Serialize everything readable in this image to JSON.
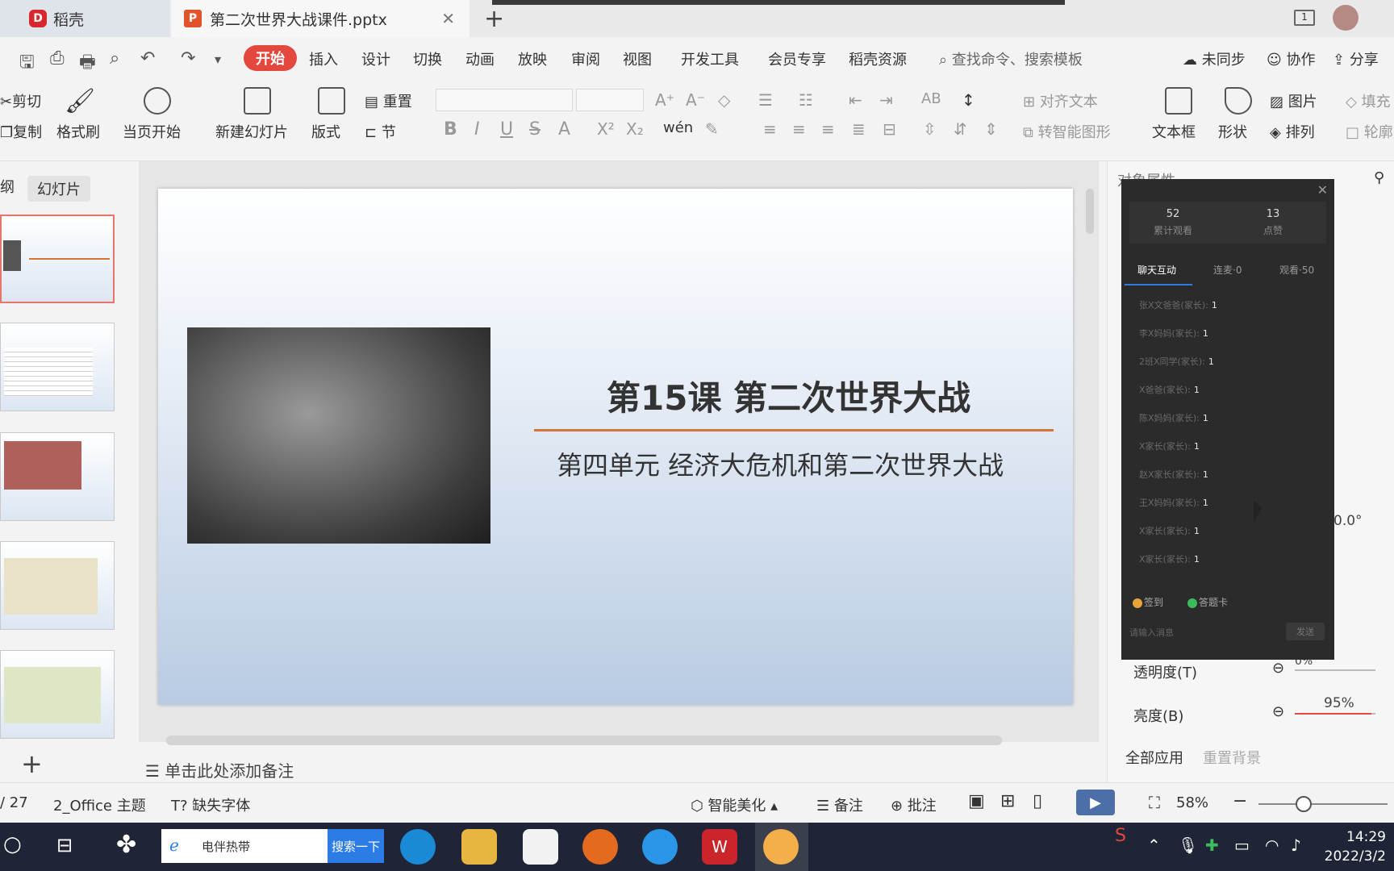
{
  "tabs": [
    {
      "label": "稻壳"
    },
    {
      "label": "第二次世界大战课件.pptx"
    }
  ],
  "menu": {
    "active": "开始",
    "items": [
      "插入",
      "设计",
      "切换",
      "动画",
      "放映",
      "审阅",
      "视图",
      "开发工具",
      "会员专享",
      "稻壳资源"
    ],
    "search_placeholder": "查找命令、搜索模板",
    "right": [
      "未同步",
      "协作",
      "分享"
    ]
  },
  "ribbon": {
    "cut": "剪切",
    "copy": "复制",
    "format_painter": "格式刷",
    "play_from_current": "当页开始",
    "new_slide": "新建幻灯片",
    "layout": "版式",
    "reset": "重置",
    "section": "节",
    "align_text": "对齐文本",
    "smart_shape": "转智能图形",
    "textbox": "文本框",
    "shape": "形状",
    "picture": "图片",
    "arrange": "排列",
    "fill": "填充",
    "outline": "轮廓"
  },
  "left_panel": {
    "tab_outline": "纲",
    "tab_slides": "幻灯片"
  },
  "slide": {
    "title": "第15课  第二次世界大战",
    "subtitle": "第四单元  经济大危机和第二次世界大战"
  },
  "notes_placeholder": "单击此处添加备注",
  "properties": {
    "title": "对象属性",
    "angle": "0.0°",
    "transparency_label": "透明度(T)",
    "transparency_value": "0%",
    "brightness_label": "亮度(B)",
    "brightness_value": "95%",
    "brightness_level": 0.95,
    "apply_all": "全部应用",
    "reset_bg": "重置背景"
  },
  "live": {
    "stats": [
      {
        "value": "52",
        "label": "累计观看"
      },
      {
        "value": "13",
        "label": "点赞"
      }
    ],
    "tabs": [
      "聊天互动",
      "连麦·0",
      "观看·50"
    ],
    "rows": [
      {
        "name": "张X文爸爸(家长):",
        "count": "1"
      },
      {
        "name": "李X妈妈(家长):",
        "count": "1"
      },
      {
        "name": "2班X同学(家长):",
        "count": "1"
      },
      {
        "name": "X爸爸(家长):",
        "count": "1"
      },
      {
        "name": "陈X妈妈(家长):",
        "count": "1"
      },
      {
        "name": "X家长(家长):",
        "count": "1"
      },
      {
        "name": "赵X家长(家长):",
        "count": "1"
      },
      {
        "name": "王X妈妈(家长):",
        "count": "1"
      },
      {
        "name": "X家长(家长):",
        "count": "1"
      },
      {
        "name": "X家长(家长):",
        "count": "1"
      }
    ],
    "signin": "签到",
    "answer_card": "答题卡",
    "input_placeholder": "请输入消息",
    "send": "发送"
  },
  "status": {
    "page": "/ 27",
    "theme": "2_Office 主题",
    "missing_font": "缺失字体",
    "smart_beautify": "智能美化",
    "notes": "备注",
    "comment": "批注",
    "zoom": "58%"
  },
  "taskbar": {
    "search_text": "电伴热带",
    "search_btn": "搜索一下",
    "time": "14:29",
    "date": "2022/3/2"
  }
}
